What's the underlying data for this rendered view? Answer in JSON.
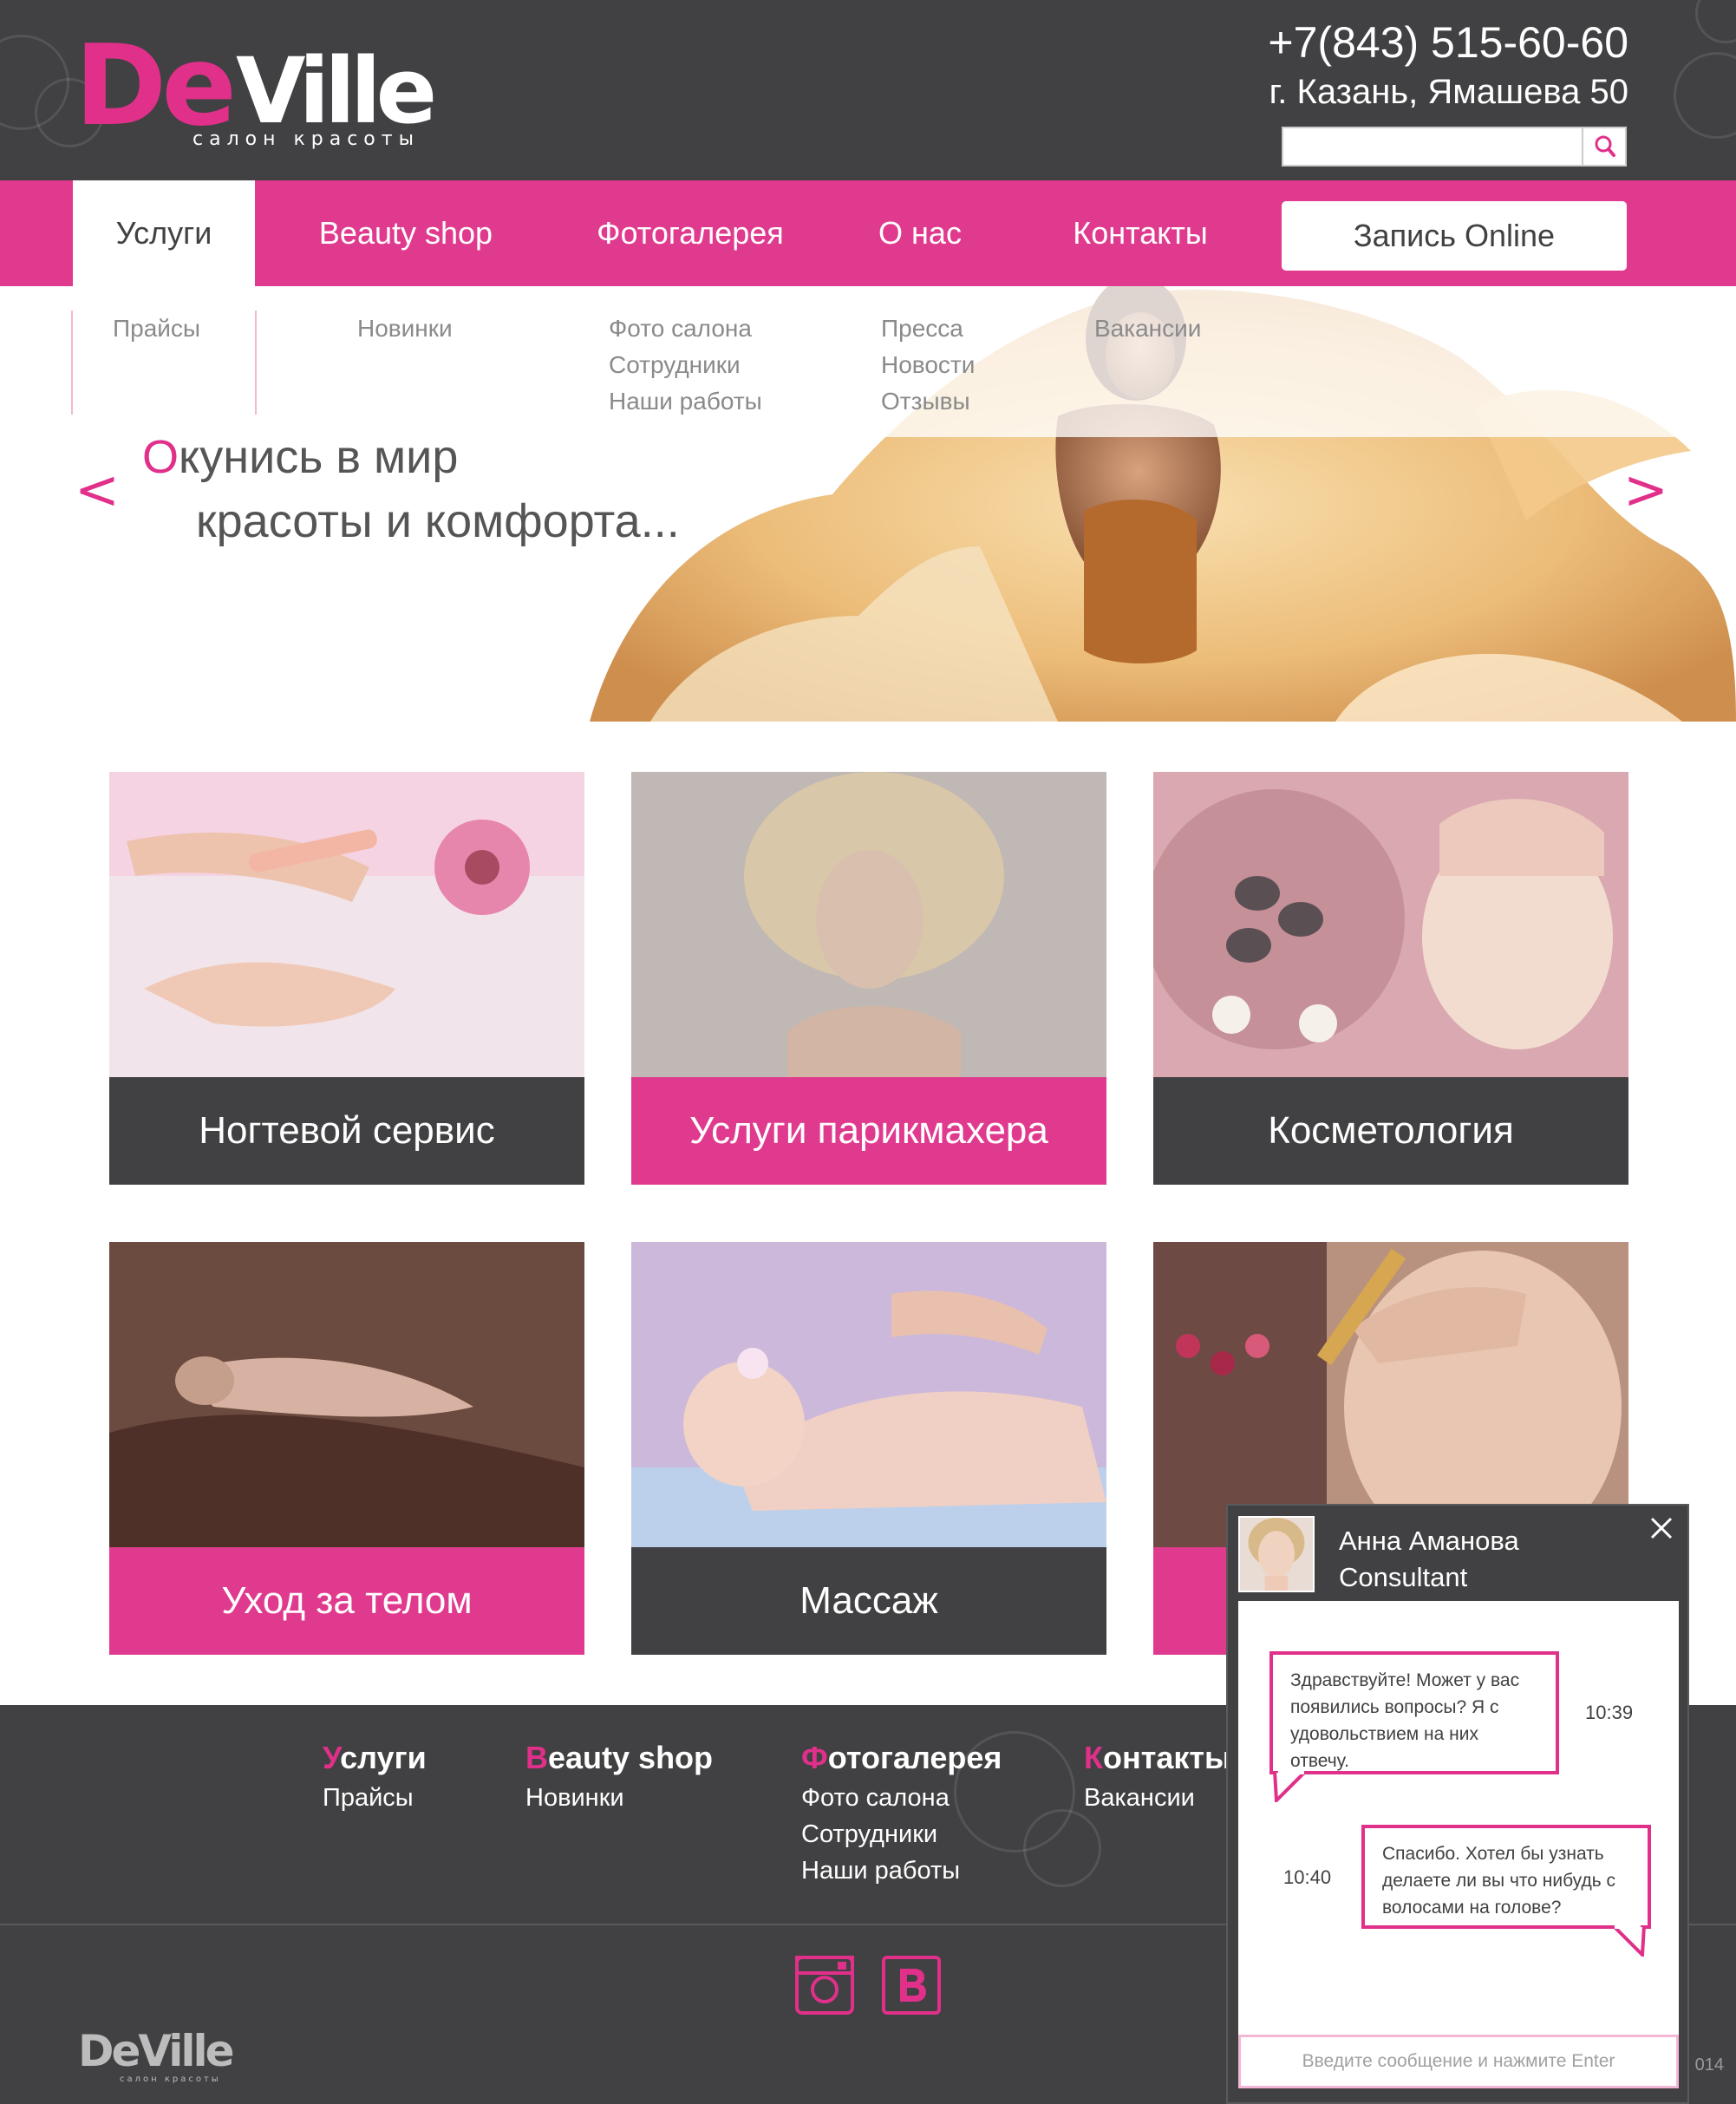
{
  "brand": {
    "name_part1": "De",
    "name_part2": "Ville",
    "tagline": "салон красоты",
    "pink": "#e0308a",
    "charcoal": "#414042"
  },
  "header": {
    "phone": "+7(843) 515-60-60",
    "address": "г. Казань, Ямашева 50",
    "search": {
      "value": "",
      "placeholder": "",
      "icon": "search-icon"
    }
  },
  "nav": {
    "items": [
      {
        "label": "Услуги",
        "active": true
      },
      {
        "label": "Beauty shop",
        "active": false
      },
      {
        "label": "Фотогалерея",
        "active": false
      },
      {
        "label": "О нас",
        "active": false
      },
      {
        "label": "Контакты",
        "active": false
      }
    ],
    "book_button": "Запись Online"
  },
  "submenu": {
    "services": [
      "Прайсы"
    ],
    "shop": [
      "Новинки"
    ],
    "gallery": [
      "Фото салона",
      "Сотрудники",
      "Наши работы"
    ],
    "about": [
      "Пресса",
      "Новости",
      "Отзывы"
    ],
    "contacts": [
      "Вакансии"
    ]
  },
  "hero": {
    "line1_first": "О",
    "line1_rest": "кунись в мир",
    "line2": "красоты и комфорта...",
    "prev": "<",
    "next": ">"
  },
  "services": [
    {
      "label": "Ногтевой сервис",
      "style": "dark"
    },
    {
      "label": "Услуги парикмахера",
      "style": "pink"
    },
    {
      "label": "Косметология",
      "style": "dark"
    },
    {
      "label": "Уход за телом",
      "style": "pink"
    },
    {
      "label": "Массаж",
      "style": "dark"
    },
    {
      "label": "",
      "style": "pink"
    }
  ],
  "footer": {
    "columns": [
      {
        "first": "У",
        "rest": "слуги",
        "links": [
          "Прайсы"
        ]
      },
      {
        "first": "B",
        "rest": "eauty shop",
        "links": [
          "Новинки"
        ]
      },
      {
        "first": "Ф",
        "rest": "отогалерея",
        "links": [
          "Фото салона",
          "Сотрудники",
          "Наши работы"
        ]
      },
      {
        "first": "К",
        "rest": "онтакты",
        "links": [
          "Вакансии"
        ]
      }
    ],
    "social": [
      "instagram-icon",
      "vk-icon"
    ],
    "logo_part1": "De",
    "logo_part2": "Ville",
    "logo_tagline": "салон красоты",
    "year_fragment": "014"
  },
  "chat": {
    "name": "Анна Аманова",
    "role": "Consultant",
    "messages": [
      {
        "text": "Здравствуйте! Может у вас появились вопросы? Я с удовольствием на них отвечу.",
        "time": "10:39",
        "side": "left"
      },
      {
        "text": "Спасибо. Хотел бы узнать делаете ли вы что нибудь с волосами на голове?",
        "time": "10:40",
        "side": "right"
      }
    ],
    "input_placeholder": "Введите сообщение и нажмите Enter"
  }
}
